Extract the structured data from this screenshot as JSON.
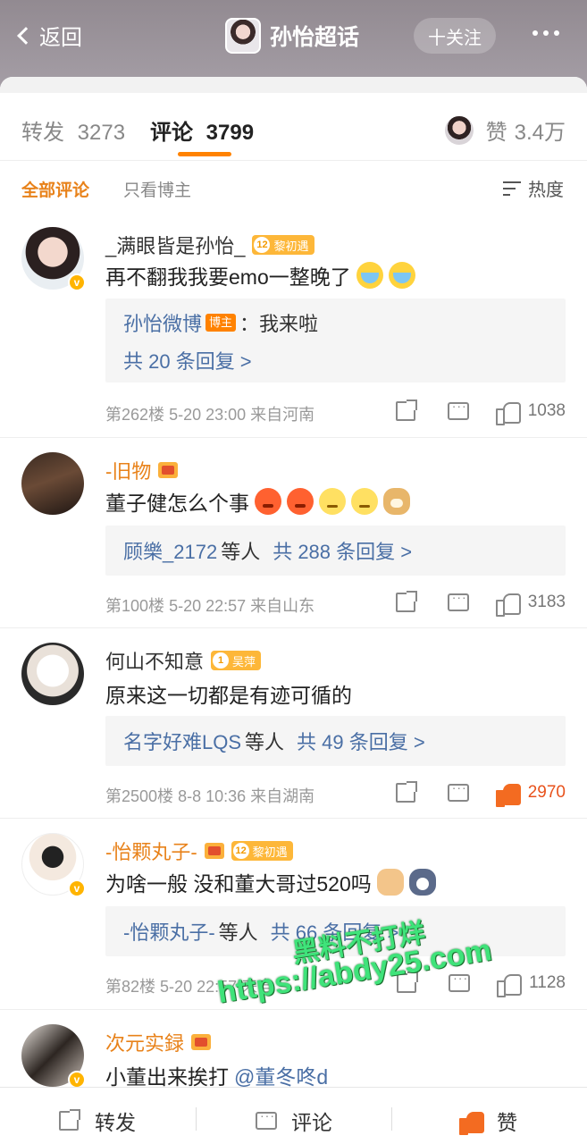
{
  "header": {
    "back_label": "返回",
    "title": "孙怡超话",
    "follow_label": "十关注"
  },
  "tabs": {
    "repost_label": "转发",
    "repost_count": "3273",
    "comment_label": "评论",
    "comment_count": "3799",
    "like_label": "赞",
    "like_count": "3.4万"
  },
  "filters": {
    "all": "全部评论",
    "author_only": "只看博主",
    "sort": "热度"
  },
  "comments": [
    {
      "user": "_满眼皆是孙怡_",
      "fan_level": "12",
      "fan_badge": "黎初遇",
      "text": "再不翻我我要emo一整晚了",
      "reply_user": "孙怡微博",
      "reply_tag": "博主",
      "reply_text": "：我来啦",
      "reply_summary": "共 20 条回复 >",
      "floor": "第262楼",
      "time": "5-20 23:00",
      "location": "来自河南",
      "likes": "1038"
    },
    {
      "user": "-旧物",
      "text": "董子健怎么个事",
      "reply_user": "顾樂_2172",
      "reply_suffix": "等人",
      "reply_summary": "共 288 条回复 >",
      "floor": "第100楼",
      "time": "5-20 22:57",
      "location": "来自山东",
      "likes": "3183"
    },
    {
      "user": "何山不知意",
      "fan_level": "1",
      "fan_badge": "吴萍",
      "text": "原来这一切都是有迹可循的",
      "reply_user": "名字好难LQS",
      "reply_suffix": "等人",
      "reply_summary": "共 49 条回复 >",
      "floor": "第2500楼",
      "time": "8-8 10:36",
      "location": "来自湖南",
      "likes": "2970"
    },
    {
      "user": "-怡颗丸子-",
      "fan_level": "12",
      "fan_badge": "黎初遇",
      "text": "为啥一般 没和董大哥过520吗",
      "reply_user": "-怡颗丸子-",
      "reply_suffix": "等人",
      "reply_summary": "共 66 条回复 >",
      "floor": "第82楼",
      "time": "5-20 22:57",
      "location": "来自",
      "likes": "1128"
    },
    {
      "user": "次元实録",
      "text": "小董出来挨打",
      "mention": "@董冬咚d"
    }
  ],
  "watermark": {
    "line1": "黑料不打烊",
    "line2": "https://abdy25.com"
  },
  "bottom_bar": {
    "repost": "转发",
    "comment": "评论",
    "like": "赞"
  },
  "colors": {
    "accent_orange": "#ff8200",
    "link_blue": "#4a6fa5",
    "header_bg": "#9a939b",
    "like_active": "#f36b21",
    "watermark_green": "#3fe37a"
  }
}
